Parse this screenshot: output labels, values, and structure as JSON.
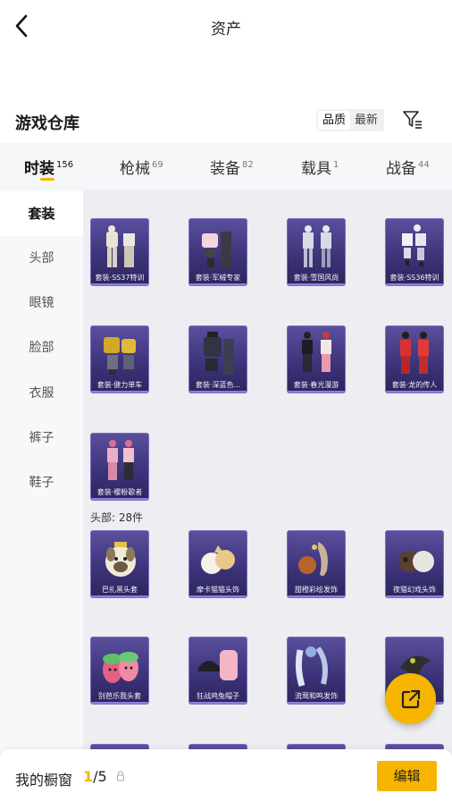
{
  "header": {
    "title": "资产",
    "back_icon": "chevron-left-icon"
  },
  "warehouse": {
    "title": "游戏仓库",
    "sort_options": [
      "品质",
      "最新"
    ],
    "active_sort": "品质",
    "filter_icon": "filter-icon"
  },
  "categories": [
    {
      "label": "时装",
      "count": "156",
      "active": true
    },
    {
      "label": "枪械",
      "count": "69"
    },
    {
      "label": "装备",
      "count": "82"
    },
    {
      "label": "载具",
      "count": "1"
    },
    {
      "label": "战备",
      "count": "44"
    }
  ],
  "sidebar": {
    "items": [
      "套装",
      "头部",
      "眼镜",
      "脸部",
      "衣服",
      "裤子",
      "鞋子"
    ],
    "active": "套装"
  },
  "sections": [
    {
      "name": "套装",
      "items": [
        "套装·SS37特训",
        "套装·军械专家",
        "套装·雪国风尚",
        "套装·SS36特训",
        "套装·健力单车",
        "套装·深蓝色...",
        "套装·春光漫游",
        "套装·龙的传人",
        "套装·樱粉歌者"
      ]
    },
    {
      "name": "头部",
      "label": "头部: 28件",
      "items": [
        "巴扎黑头套",
        "摩卡猫猫头饰",
        "甜橙彩绘发饰",
        "夜猫幻戏头饰",
        "别芭乐我头套",
        "狂战鸡兔帽子",
        "流莺和鸣发饰",
        ""
      ]
    }
  ],
  "bottom": {
    "showcase_label": "我的橱窗",
    "current": "1",
    "total": "/5",
    "edit_label": "编辑"
  },
  "colors": {
    "accent": "#f7b500",
    "card_bg": "#3b3278"
  }
}
